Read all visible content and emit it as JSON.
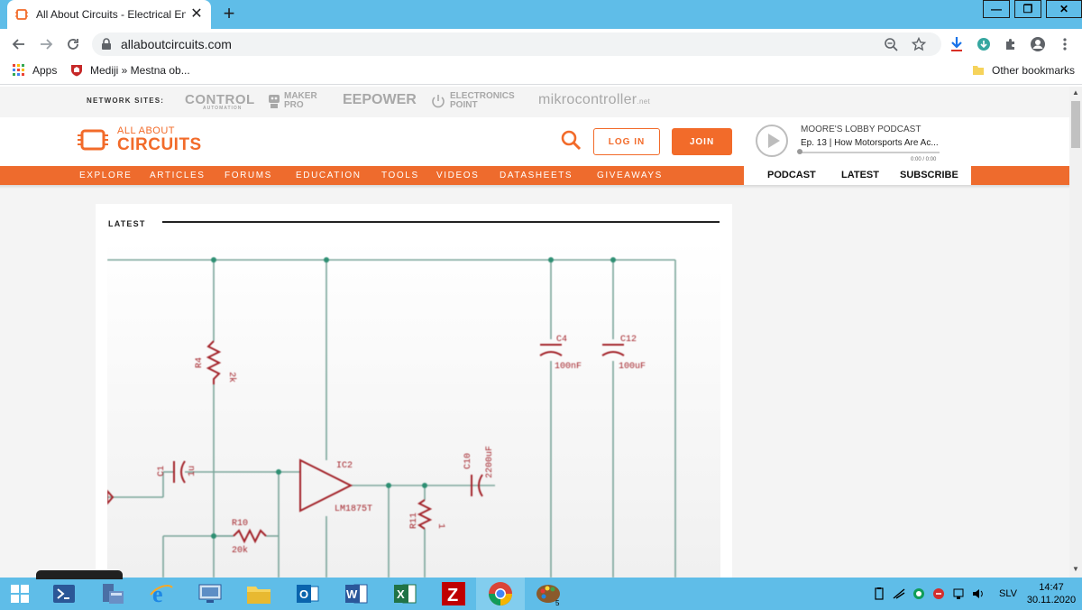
{
  "browser": {
    "tab_title": "All About Circuits - Electrical Eng",
    "tab_close": "✕",
    "new_tab": "+",
    "url": "allaboutcircuits.com",
    "window_controls": {
      "minimize": "—",
      "maximize": "❐",
      "close": "✕"
    }
  },
  "bookmarks": {
    "apps_label": "Apps",
    "item1_label": "Mediji » Mestna ob...",
    "other_label": "Other bookmarks"
  },
  "site": {
    "network_label": "NETWORK SITES:",
    "network_sites": [
      "CONTROL",
      "MAKER PRO",
      "EEPOWER",
      "ELECTRONICS POINT",
      "mikrocontroller"
    ],
    "network_site_subs": [
      "AUTOMATION",
      "",
      "",
      "",
      ".net"
    ],
    "logo_small": "ALL ABOUT",
    "logo_big": "CIRCUITS",
    "login_label": "LOG IN",
    "join_label": "JOIN",
    "podcast": {
      "title": "MOORE'S LOBBY PODCAST",
      "episode": "Ep. 13 | How Motorsports Are Ac...",
      "time": "0:00 / 0:00",
      "progress": 0
    },
    "nav": [
      "EXPLORE",
      "ARTICLES",
      "FORUMS",
      "EDUCATION",
      "TOOLS",
      "VIDEOS",
      "DATASHEETS",
      "GIVEAWAYS"
    ],
    "podcast_tabs": [
      "PODCAST",
      "LATEST",
      "SUBSCRIBE"
    ],
    "latest_label": "LATEST",
    "schematic_labels": {
      "r4": "R4",
      "r4_val": "2k",
      "c4": "C4",
      "c4_val": "100nF",
      "c12": "C12",
      "c12_val": "100uF",
      "c_in": "C1",
      "c_in_val": "1u",
      "ic": "IC2",
      "ic_part": "LM1875T",
      "r10": "R10",
      "r10_val": "20k",
      "r11": "R11",
      "r11_val": "1",
      "c10": "C10",
      "c10_val": "2200uF"
    }
  },
  "taskbar": {
    "lang": "SLV",
    "time": "14:47",
    "date": "30.11.2020"
  },
  "colors": {
    "brand_orange": "#ee6b2d",
    "chrome_blue": "#5fbde8",
    "schematic_red": "#a3232a",
    "schematic_wire": "#6f9f93"
  }
}
